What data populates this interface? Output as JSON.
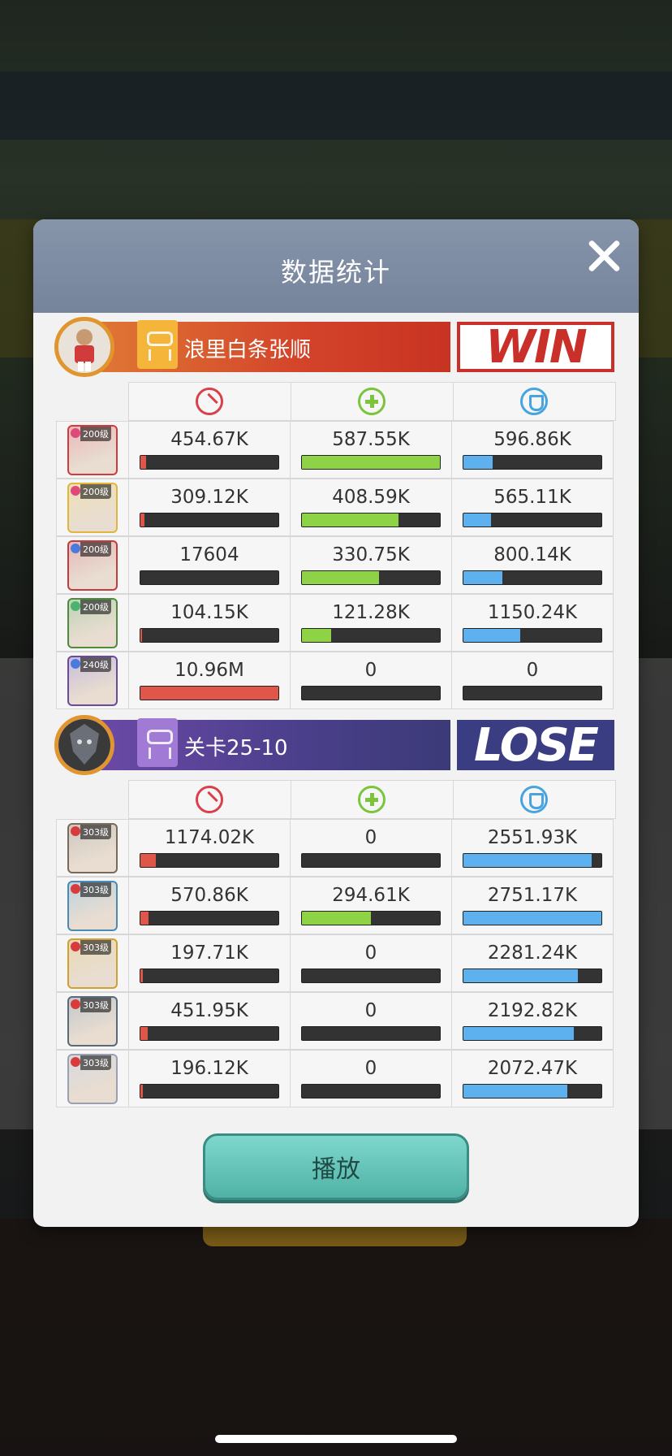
{
  "modal": {
    "title": "数据统计",
    "play_label": "播放"
  },
  "colors": {
    "damage": "#e0574a",
    "heal": "#8ed345",
    "defense": "#5db1ef",
    "play_button": "#5fc3b7"
  },
  "stat_headers": [
    {
      "icon": "attack-icon"
    },
    {
      "icon": "heal-icon"
    },
    {
      "icon": "defense-icon"
    }
  ],
  "team_win": {
    "name": "浪里白条张顺",
    "result": "WIN",
    "heroes": [
      {
        "level": "200级",
        "gem": "#e04a7a",
        "frame": "#d23b3b",
        "damage": "454.67K",
        "damage_pct": 0.04,
        "heal": "587.55K",
        "heal_pct": 1.0,
        "defense": "596.86K",
        "defense_pct": 0.21
      },
      {
        "level": "200级",
        "gem": "#e04a7a",
        "frame": "#e0b53a",
        "damage": "309.12K",
        "damage_pct": 0.03,
        "heal": "408.59K",
        "heal_pct": 0.7,
        "defense": "565.11K",
        "defense_pct": 0.2
      },
      {
        "level": "200级",
        "gem": "#4a7ae0",
        "frame": "#c23c3c",
        "damage": "17604",
        "damage_pct": 0.0,
        "heal": "330.75K",
        "heal_pct": 0.56,
        "defense": "800.14K",
        "defense_pct": 0.28
      },
      {
        "level": "200级",
        "gem": "#4ab46a",
        "frame": "#4e8b3d",
        "damage": "104.15K",
        "damage_pct": 0.01,
        "heal": "121.28K",
        "heal_pct": 0.21,
        "defense": "1150.24K",
        "defense_pct": 0.41
      },
      {
        "level": "240级",
        "gem": "#4a7ae0",
        "frame": "#6a4aa0",
        "damage": "10.96M",
        "damage_pct": 1.0,
        "heal": "0",
        "heal_pct": 0.0,
        "defense": "0",
        "defense_pct": 0.0
      }
    ]
  },
  "team_lose": {
    "name": "关卡25-10",
    "result": "LOSE",
    "heroes": [
      {
        "level": "303级",
        "gem": "#d93a3a",
        "frame": "#7a6a5a",
        "damage": "1174.02K",
        "damage_pct": 0.11,
        "heal": "0",
        "heal_pct": 0.0,
        "defense": "2551.93K",
        "defense_pct": 0.93
      },
      {
        "level": "303级",
        "gem": "#d93a3a",
        "frame": "#4a8ab4",
        "damage": "570.86K",
        "damage_pct": 0.06,
        "heal": "294.61K",
        "heal_pct": 0.5,
        "defense": "2751.17K",
        "defense_pct": 1.0
      },
      {
        "level": "303级",
        "gem": "#d93a3a",
        "frame": "#d0a030",
        "damage": "197.71K",
        "damage_pct": 0.02,
        "heal": "0",
        "heal_pct": 0.0,
        "defense": "2281.24K",
        "defense_pct": 0.83
      },
      {
        "level": "303级",
        "gem": "#d93a3a",
        "frame": "#5a6a7a",
        "damage": "451.95K",
        "damage_pct": 0.05,
        "heal": "0",
        "heal_pct": 0.0,
        "defense": "2192.82K",
        "defense_pct": 0.8
      },
      {
        "level": "303级",
        "gem": "#d93a3a",
        "frame": "#9aa0b4",
        "damage": "196.12K",
        "damage_pct": 0.02,
        "heal": "0",
        "heal_pct": 0.0,
        "defense": "2072.47K",
        "defense_pct": 0.75
      }
    ]
  }
}
